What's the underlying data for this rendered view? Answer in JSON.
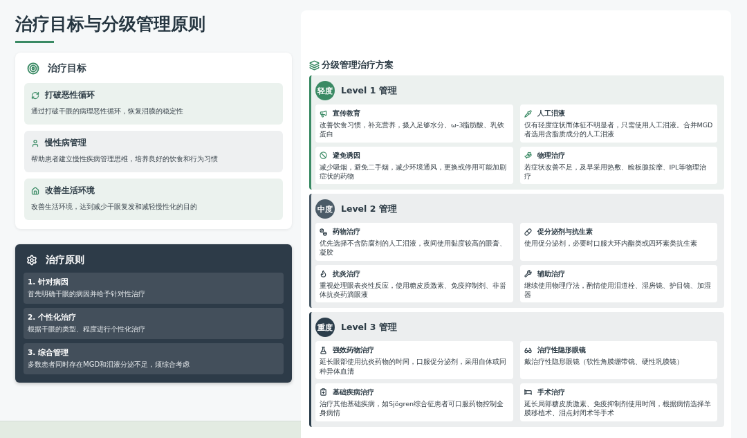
{
  "title": "治疗目标与分级管理原则",
  "goals": {
    "heading": "治疗目标",
    "items": [
      {
        "title": "打破恶性循环",
        "text": "通过打破干眼的病理恶性循环，恢复泪膜的稳定性"
      },
      {
        "title": "慢性病管理",
        "text": "帮助患者建立慢性疾病管理思维，培养良好的饮食和行为习惯"
      },
      {
        "title": "改善生活环境",
        "text": "改善生活环境，达到减少干眼复发和减轻慢性化的目的"
      }
    ]
  },
  "principles": {
    "heading": "治疗原则",
    "items": [
      {
        "title": "1. 针对病因",
        "text": "首先明确干眼的病因并给予针对性治疗"
      },
      {
        "title": "2. 个性化治疗",
        "text": "根据干眼的类型、程度进行个性化治疗"
      },
      {
        "title": "3. 综合管理",
        "text": "多数患者同时存在MGD和泪液分泌不足，须综合考虑"
      }
    ]
  },
  "plan": {
    "heading": "分级管理治疗方案",
    "levels": [
      {
        "badge": "轻度",
        "title": "Level 1 管理",
        "color": "#3a8a64",
        "cards": [
          {
            "title": "宣传教育",
            "text": "改善饮食习惯，补充营养，摄入足够水分、ω-3脂肪酸、乳铁蛋白"
          },
          {
            "title": "人工泪液",
            "text": "仅有轻度症状而体征不明显者，只需使用人工泪液。合并MGD者选用含脂质成分的人工泪液"
          },
          {
            "title": "避免诱因",
            "text": "减少吸烟，避免二手烟，减少环境通风，更换或停用可能加剧症状的药物"
          },
          {
            "title": "物理治疗",
            "text": "若症状改善不足，及早采用热敷、睑板腺按摩、IPL等物理治疗"
          }
        ]
      },
      {
        "badge": "中度",
        "title": "Level 2 管理",
        "color": "#4b5b67",
        "cards": [
          {
            "title": "药物治疗",
            "text": "优先选择不含防腐剂的人工泪液，夜间使用黏度较高的眼膏、凝胶"
          },
          {
            "title": "促分泌剂与抗生素",
            "text": "使用促分泌剂，必要时口服大环内酯类或四环素类抗生素"
          },
          {
            "title": "抗炎治疗",
            "text": "重视处理眼表炎性反应，使用糖皮质激素、免疫抑制剂、非甾体抗炎药滴眼液"
          },
          {
            "title": "辅助治疗",
            "text": "继续使用物理疗法，酌情使用泪道栓、湿房镜、护目镜、加湿器"
          }
        ]
      },
      {
        "badge": "重度",
        "title": "Level 3 管理",
        "color": "#2c3e4c",
        "cards": [
          {
            "title": "强效药物治疗",
            "text": "延长眼部使用抗炎药物的时间，口服促分泌剂，采用自体或同种异体血清"
          },
          {
            "title": "治疗性隐形眼镜",
            "text": "戴治疗性隐形眼镜（软性角膜绷带镜、硬性巩膜镜）"
          },
          {
            "title": "基础疾病治疗",
            "text": "治疗其他基础疾病，如Sjögren综合征患者可口服药物控制全身病情"
          },
          {
            "title": "手术治疗",
            "text": "延长局部糖皮质激素、免疫抑制剂使用时间，根据病情选择羊膜移植术、泪点封闭术等手术"
          }
        ]
      }
    ]
  }
}
